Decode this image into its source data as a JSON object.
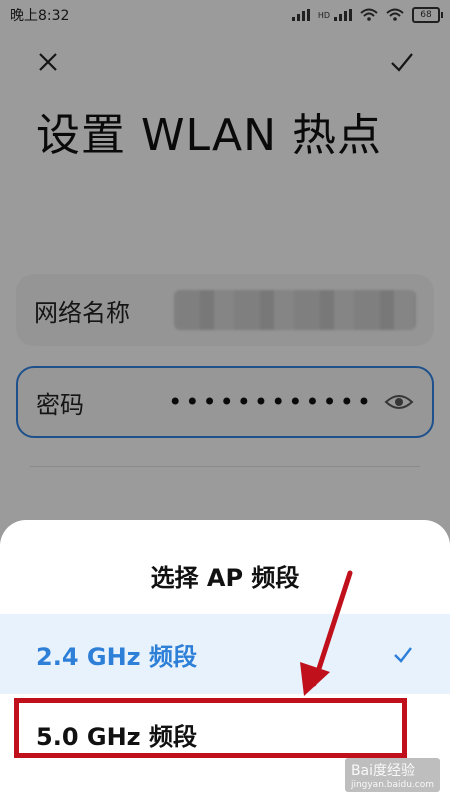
{
  "status_bar": {
    "time": "晚上8:32",
    "network_type": "HD",
    "battery_level": "68"
  },
  "screen": {
    "title": "设置 WLAN 热点",
    "fields": {
      "network_name_label": "网络名称",
      "password_label": "密码",
      "password_mask": "••••••••••••"
    }
  },
  "bottom_sheet": {
    "title": "选择 AP 频段",
    "options": [
      {
        "label": "2.4 GHz 频段",
        "selected": true
      },
      {
        "label": "5.0 GHz 频段",
        "selected": false
      }
    ]
  },
  "annotation": {
    "highlight_color": "#c0101c"
  },
  "watermark": {
    "text": "Bai度经验",
    "subtext": "jingyan.baidu.com"
  },
  "colors": {
    "accent": "#2e7fd8",
    "selected_bg": "#e7f2fc"
  },
  "icons": {
    "close": "close-icon",
    "confirm": "check-icon",
    "password_visibility": "eye-icon"
  }
}
